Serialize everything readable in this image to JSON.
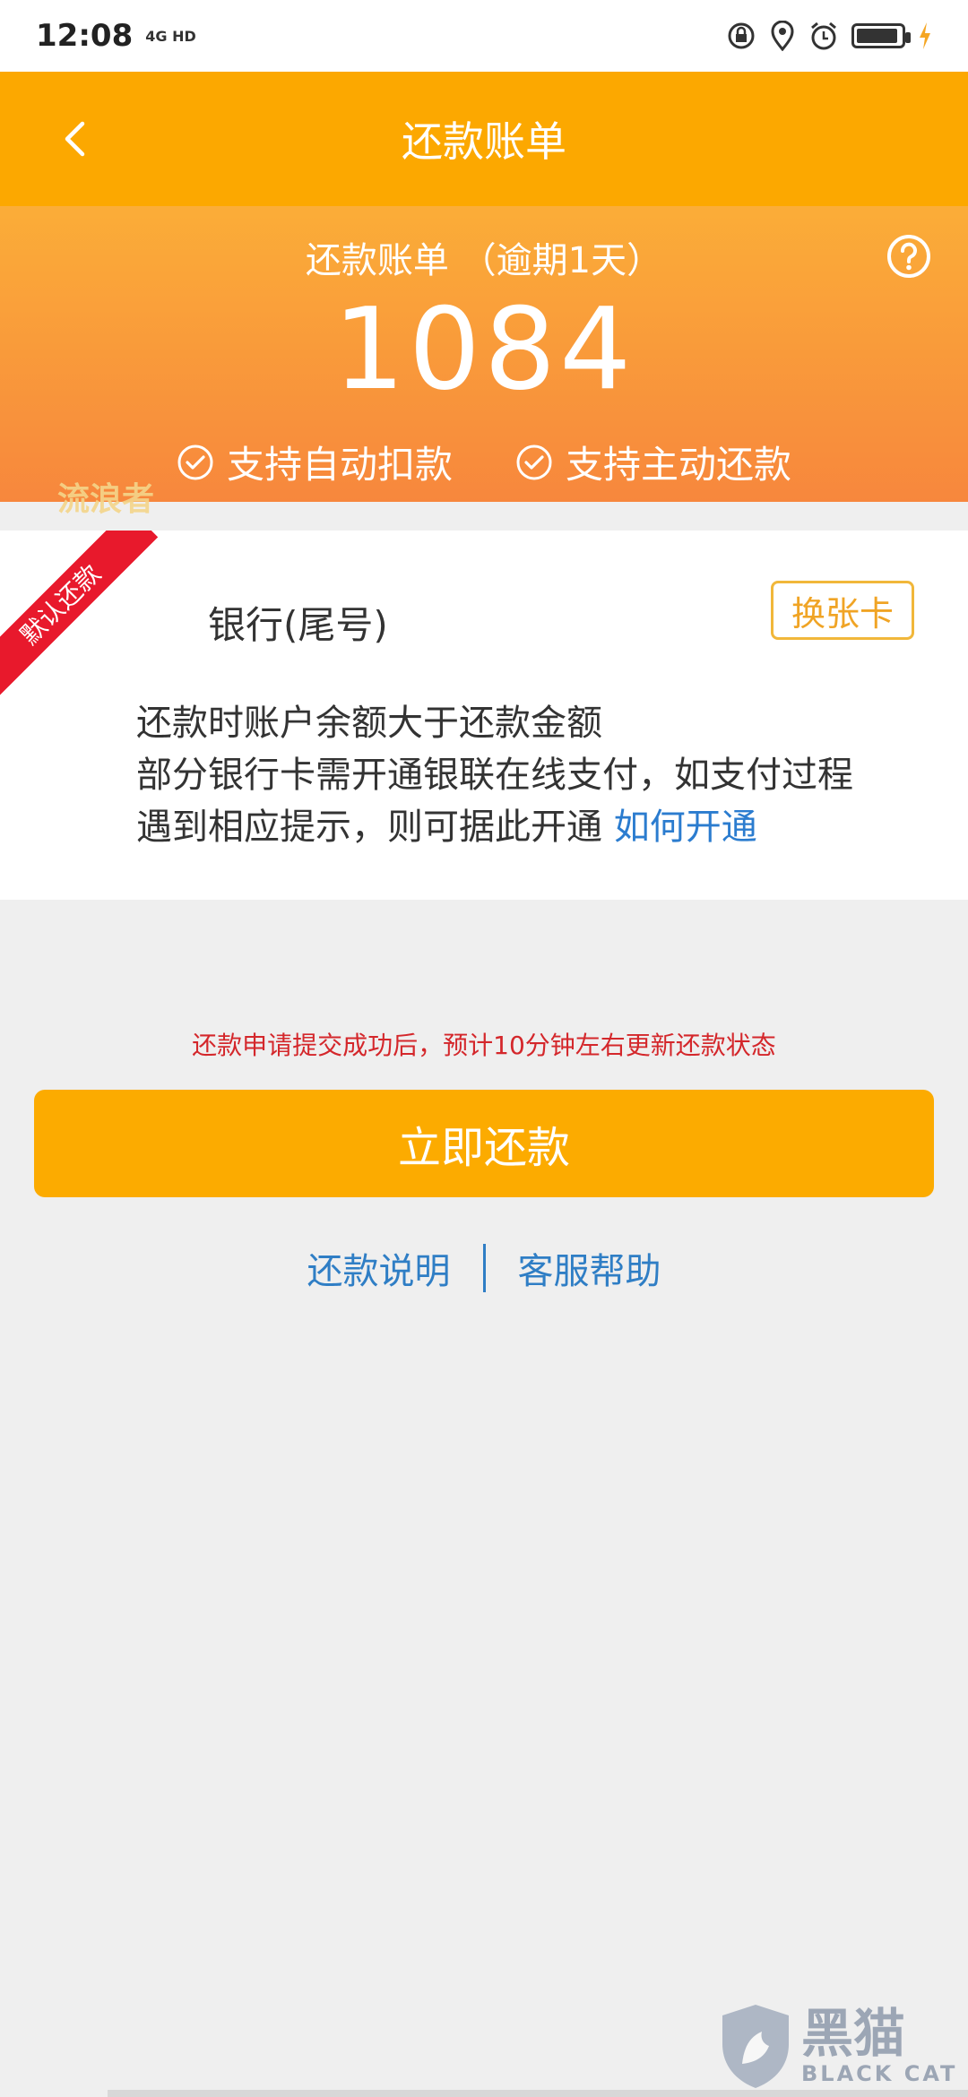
{
  "status_bar": {
    "time": "12:08",
    "network": "4G HD",
    "icons": [
      "lock-rotation-icon",
      "location-icon",
      "alarm-icon",
      "battery-icon",
      "charging-icon"
    ]
  },
  "nav": {
    "title": "还款账单",
    "back_icon": "chevron-left-icon"
  },
  "summary": {
    "subtitle": "还款账单 （逾期1天）",
    "amount": "1084",
    "help_icon": "question-circle-icon",
    "features": [
      "支持自动扣款",
      "支持主动还款"
    ]
  },
  "watermark_top": "流浪者",
  "card": {
    "ribbon": "默认还款",
    "bank_name": "银行(尾号)",
    "switch_label": "换张卡",
    "note_line1": "还款时账户余额大于还款金额",
    "note_line2": "部分银行卡需开通银联在线支付，如支付过程",
    "note_line3": "遇到相应提示，则可据此开通",
    "note_link": "如何开通"
  },
  "hint": "还款申请提交成功后，预计10分钟左右更新还款状态",
  "pay_button": "立即还款",
  "links": {
    "explain": "还款说明",
    "help": "客服帮助"
  },
  "bottom_watermark": {
    "cn": "黑猫",
    "en": "BLACK CAT"
  },
  "colors": {
    "nav_bg": "#fca800",
    "button_bg": "#fcab00",
    "link": "#2b7ccf",
    "hint": "#d4272b",
    "ribbon": "#e8192c"
  }
}
